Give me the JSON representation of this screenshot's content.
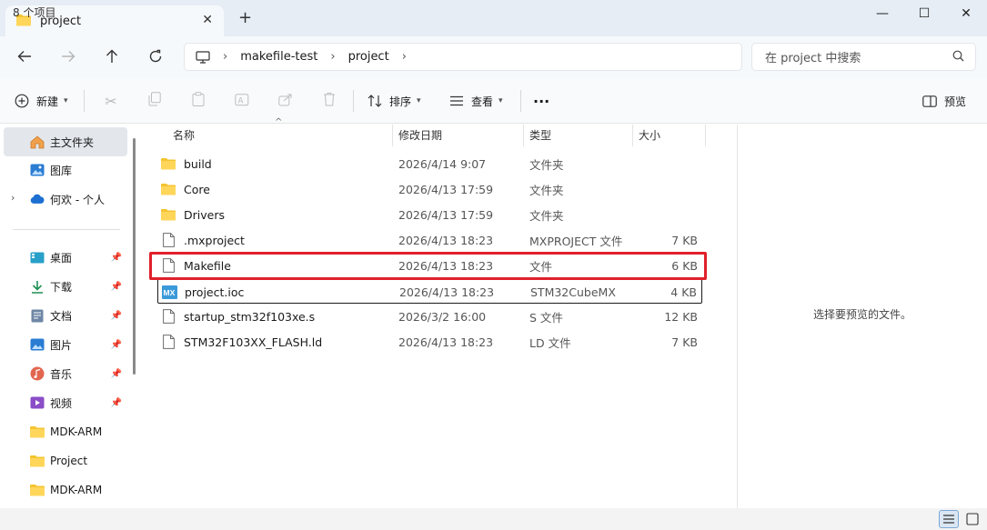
{
  "window": {
    "tab_title": "project",
    "new_tab": "+",
    "tab_close": "✕",
    "minimize": "—",
    "maximize": "☐",
    "close": "✕"
  },
  "address": {
    "crumbs": [
      "makefile-test",
      "project"
    ],
    "search_placeholder": "在 project 中搜索"
  },
  "toolbar": {
    "new_label": "新建",
    "sort_label": "排序",
    "view_label": "查看",
    "more_label": "···",
    "preview_label": "预览"
  },
  "sidebar": {
    "home": "主文件夹",
    "gallery": "图库",
    "onedrive": "何欢 - 个人",
    "quick": [
      {
        "label": "桌面",
        "icon": "desktop-icon"
      },
      {
        "label": "下载",
        "icon": "download-icon"
      },
      {
        "label": "文档",
        "icon": "documents-icon"
      },
      {
        "label": "图片",
        "icon": "pictures-icon"
      },
      {
        "label": "音乐",
        "icon": "music-icon"
      },
      {
        "label": "视频",
        "icon": "video-icon"
      }
    ],
    "folders": [
      "MDK-ARM",
      "Project",
      "MDK-ARM"
    ]
  },
  "columns": {
    "name": "名称",
    "date": "修改日期",
    "type": "类型",
    "size": "大小"
  },
  "files": [
    {
      "name": "build",
      "date": "2026/4/14 9:07",
      "type": "文件夹",
      "size": "",
      "icon": "folder-icon"
    },
    {
      "name": "Core",
      "date": "2026/4/13 17:59",
      "type": "文件夹",
      "size": "",
      "icon": "folder-icon"
    },
    {
      "name": "Drivers",
      "date": "2026/4/13 17:59",
      "type": "文件夹",
      "size": "",
      "icon": "folder-icon"
    },
    {
      "name": ".mxproject",
      "date": "2026/4/13 18:23",
      "type": "MXPROJECT 文件",
      "size": "7 KB",
      "icon": "file-icon"
    },
    {
      "name": "Makefile",
      "date": "2026/4/13 18:23",
      "type": "文件",
      "size": "6 KB",
      "icon": "file-icon"
    },
    {
      "name": "project.ioc",
      "date": "2026/4/13 18:23",
      "type": "STM32CubeMX",
      "size": "4 KB",
      "icon": "stm32cubemx-icon"
    },
    {
      "name": "startup_stm32f103xe.s",
      "date": "2026/3/2 16:00",
      "type": "S 文件",
      "size": "12 KB",
      "icon": "file-icon"
    },
    {
      "name": "STM32F103XX_FLASH.ld",
      "date": "2026/4/13 18:23",
      "type": "LD 文件",
      "size": "7 KB",
      "icon": "file-icon"
    }
  ],
  "preview_message": "选择要预览的文件。",
  "status": {
    "item_count": "8 个项目"
  }
}
